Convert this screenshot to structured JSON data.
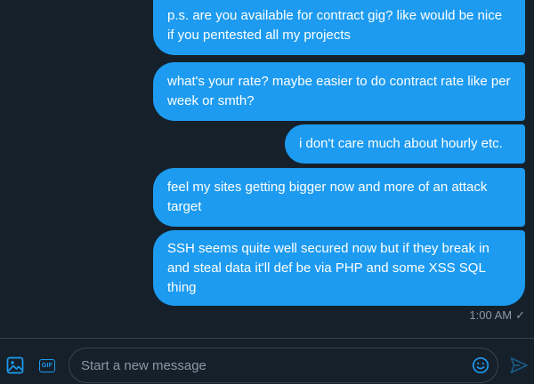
{
  "conversation": {
    "messages": [
      {
        "text": "p.s. are you available for contract gig? like would be nice if you pentested all my projects"
      },
      {
        "text": "what's your rate? maybe easier to do contract rate like per week or smth?"
      },
      {
        "text": "i don't care much about hourly etc."
      },
      {
        "text": "feel my sites getting bigger now and more of an attack target"
      },
      {
        "text": "SSH seems quite well secured now but if they break in and steal data it'll def be via PHP and some XSS SQL thing"
      }
    ],
    "timestamp": "1:00 AM",
    "read_mark": "✓"
  },
  "composer": {
    "placeholder": "Start a new message",
    "value": "",
    "gif_label": "GIF",
    "icons": [
      "media-icon",
      "gif-icon",
      "emoji-icon",
      "send-icon"
    ]
  },
  "colors": {
    "background": "#15202b",
    "bubble": "#1d9bf0",
    "accent": "#1d9bf0",
    "muted_text": "#8b98a5",
    "border": "#38444d"
  }
}
